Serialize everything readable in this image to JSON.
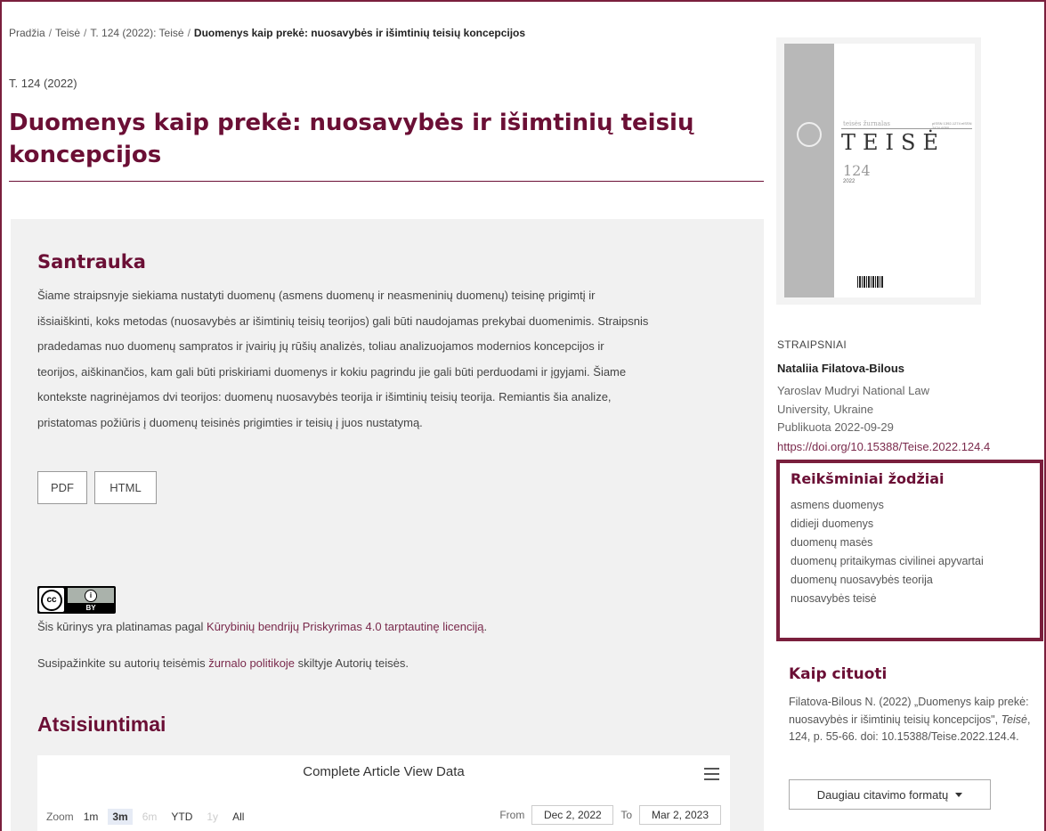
{
  "breadcrumb": {
    "home": "Pradžia",
    "section": "Teisė",
    "issue": "T. 124 (2022): Teisė",
    "current": "Duomenys kaip prekė: nuosavybės ir išimtinių teisių koncepcijos",
    "separator": "/"
  },
  "issue_label": "T. 124 (2022)",
  "article_title": "Duomenys kaip prekė: nuosavybės ir išimtinių teisių koncepcijos",
  "abstract": {
    "heading": "Santrauka",
    "lines": [
      "Šiame straipsnyje siekiama nustatyti duomenų (asmens duomenų ir neasmeninių duomenų) teisinę prigimtį ir",
      "išsiaiškinti, koks metodas (nuosavybės ar išimtinių teisių teorijos) gali būti naudojamas prekybai duomenimis. Straipsnis",
      "pradedamas nuo duomenų sampratos ir įvairių jų rūšių analizės, toliau analizuojamos modernios koncepcijos ir",
      "teorijos, aiškinančios, kam gali būti priskiriami duomenys ir kokiu pagrindu jie gali būti perduodami ir įgyjami. Šiame",
      "kontekste nagrinėjamos dvi teorijos: duomenų nuosavybės teorija ir išimtinių teisių teorija. Remiantis šia analize,",
      "pristatomas požiūris į duomenų teisinės prigimties ir teisių į juos nustatymą."
    ]
  },
  "galleys": {
    "pdf": "PDF",
    "html": "HTML"
  },
  "license": {
    "cc_label": "cc",
    "by_label": "BY",
    "prefix": "Šis kūrinys yra platinamas pagal ",
    "link": "Kūrybinių bendrijų Priskyrimas 4.0 tarptautinę licenciją",
    "suffix": "."
  },
  "policy": {
    "prefix": "Susipažinkite su autorių teisėmis ",
    "link": "žurnalo politikoje",
    "suffix": " skiltyje Autorių teisės."
  },
  "downloads": {
    "heading": "Atsisiuntimai",
    "chart_title": "Complete Article View Data",
    "zoom_label": "Zoom",
    "zoom_options": [
      "1m",
      "3m",
      "6m",
      "YTD",
      "1y",
      "All"
    ],
    "from_label": "From",
    "from_value": "Dec 2, 2022",
    "to_label": "To",
    "to_value": "Mar 2, 2023"
  },
  "cover": {
    "subtitle": "teisės žurnalas",
    "issn": "pISSN 1392-1274 eISSN 2424-6050",
    "title": "TEISĖ",
    "number": "124",
    "year": "2022"
  },
  "sidebar": {
    "section_label": "STRAIPSNIAI",
    "author_name": "Nataliia Filatova-Bilous",
    "author_affiliation": "Yaroslav Mudryi National Law University, Ukraine",
    "published": "Publikuota 2022-09-29",
    "doi": "https://doi.org/10.15388/Teise.2022.124.4"
  },
  "keywords": {
    "heading": "Reikšminiai žodžiai",
    "items": [
      "asmens duomenys",
      "didieji duomenys",
      "duomenų masės",
      "duomenų pritaikymas civilinei apyvartai",
      "duomenų nuosavybės teorija",
      "nuosavybės teisė"
    ]
  },
  "citation": {
    "heading": "Kaip cituoti",
    "text_before": "Filatova-Bilous N. (2022) „Duomenys kaip prekė: nuosavybės ir išimtinių teisių koncepcijos\", ",
    "journal": "Teisė",
    "text_after": ", 124, p. 55-66. doi: 10.15388/Teise.2022.124.4.",
    "button": "Daugiau citavimo formatų"
  },
  "colors": {
    "brand": "#6b0f35",
    "link": "#7a2a4c",
    "panel_bg": "#f1f1f1"
  }
}
